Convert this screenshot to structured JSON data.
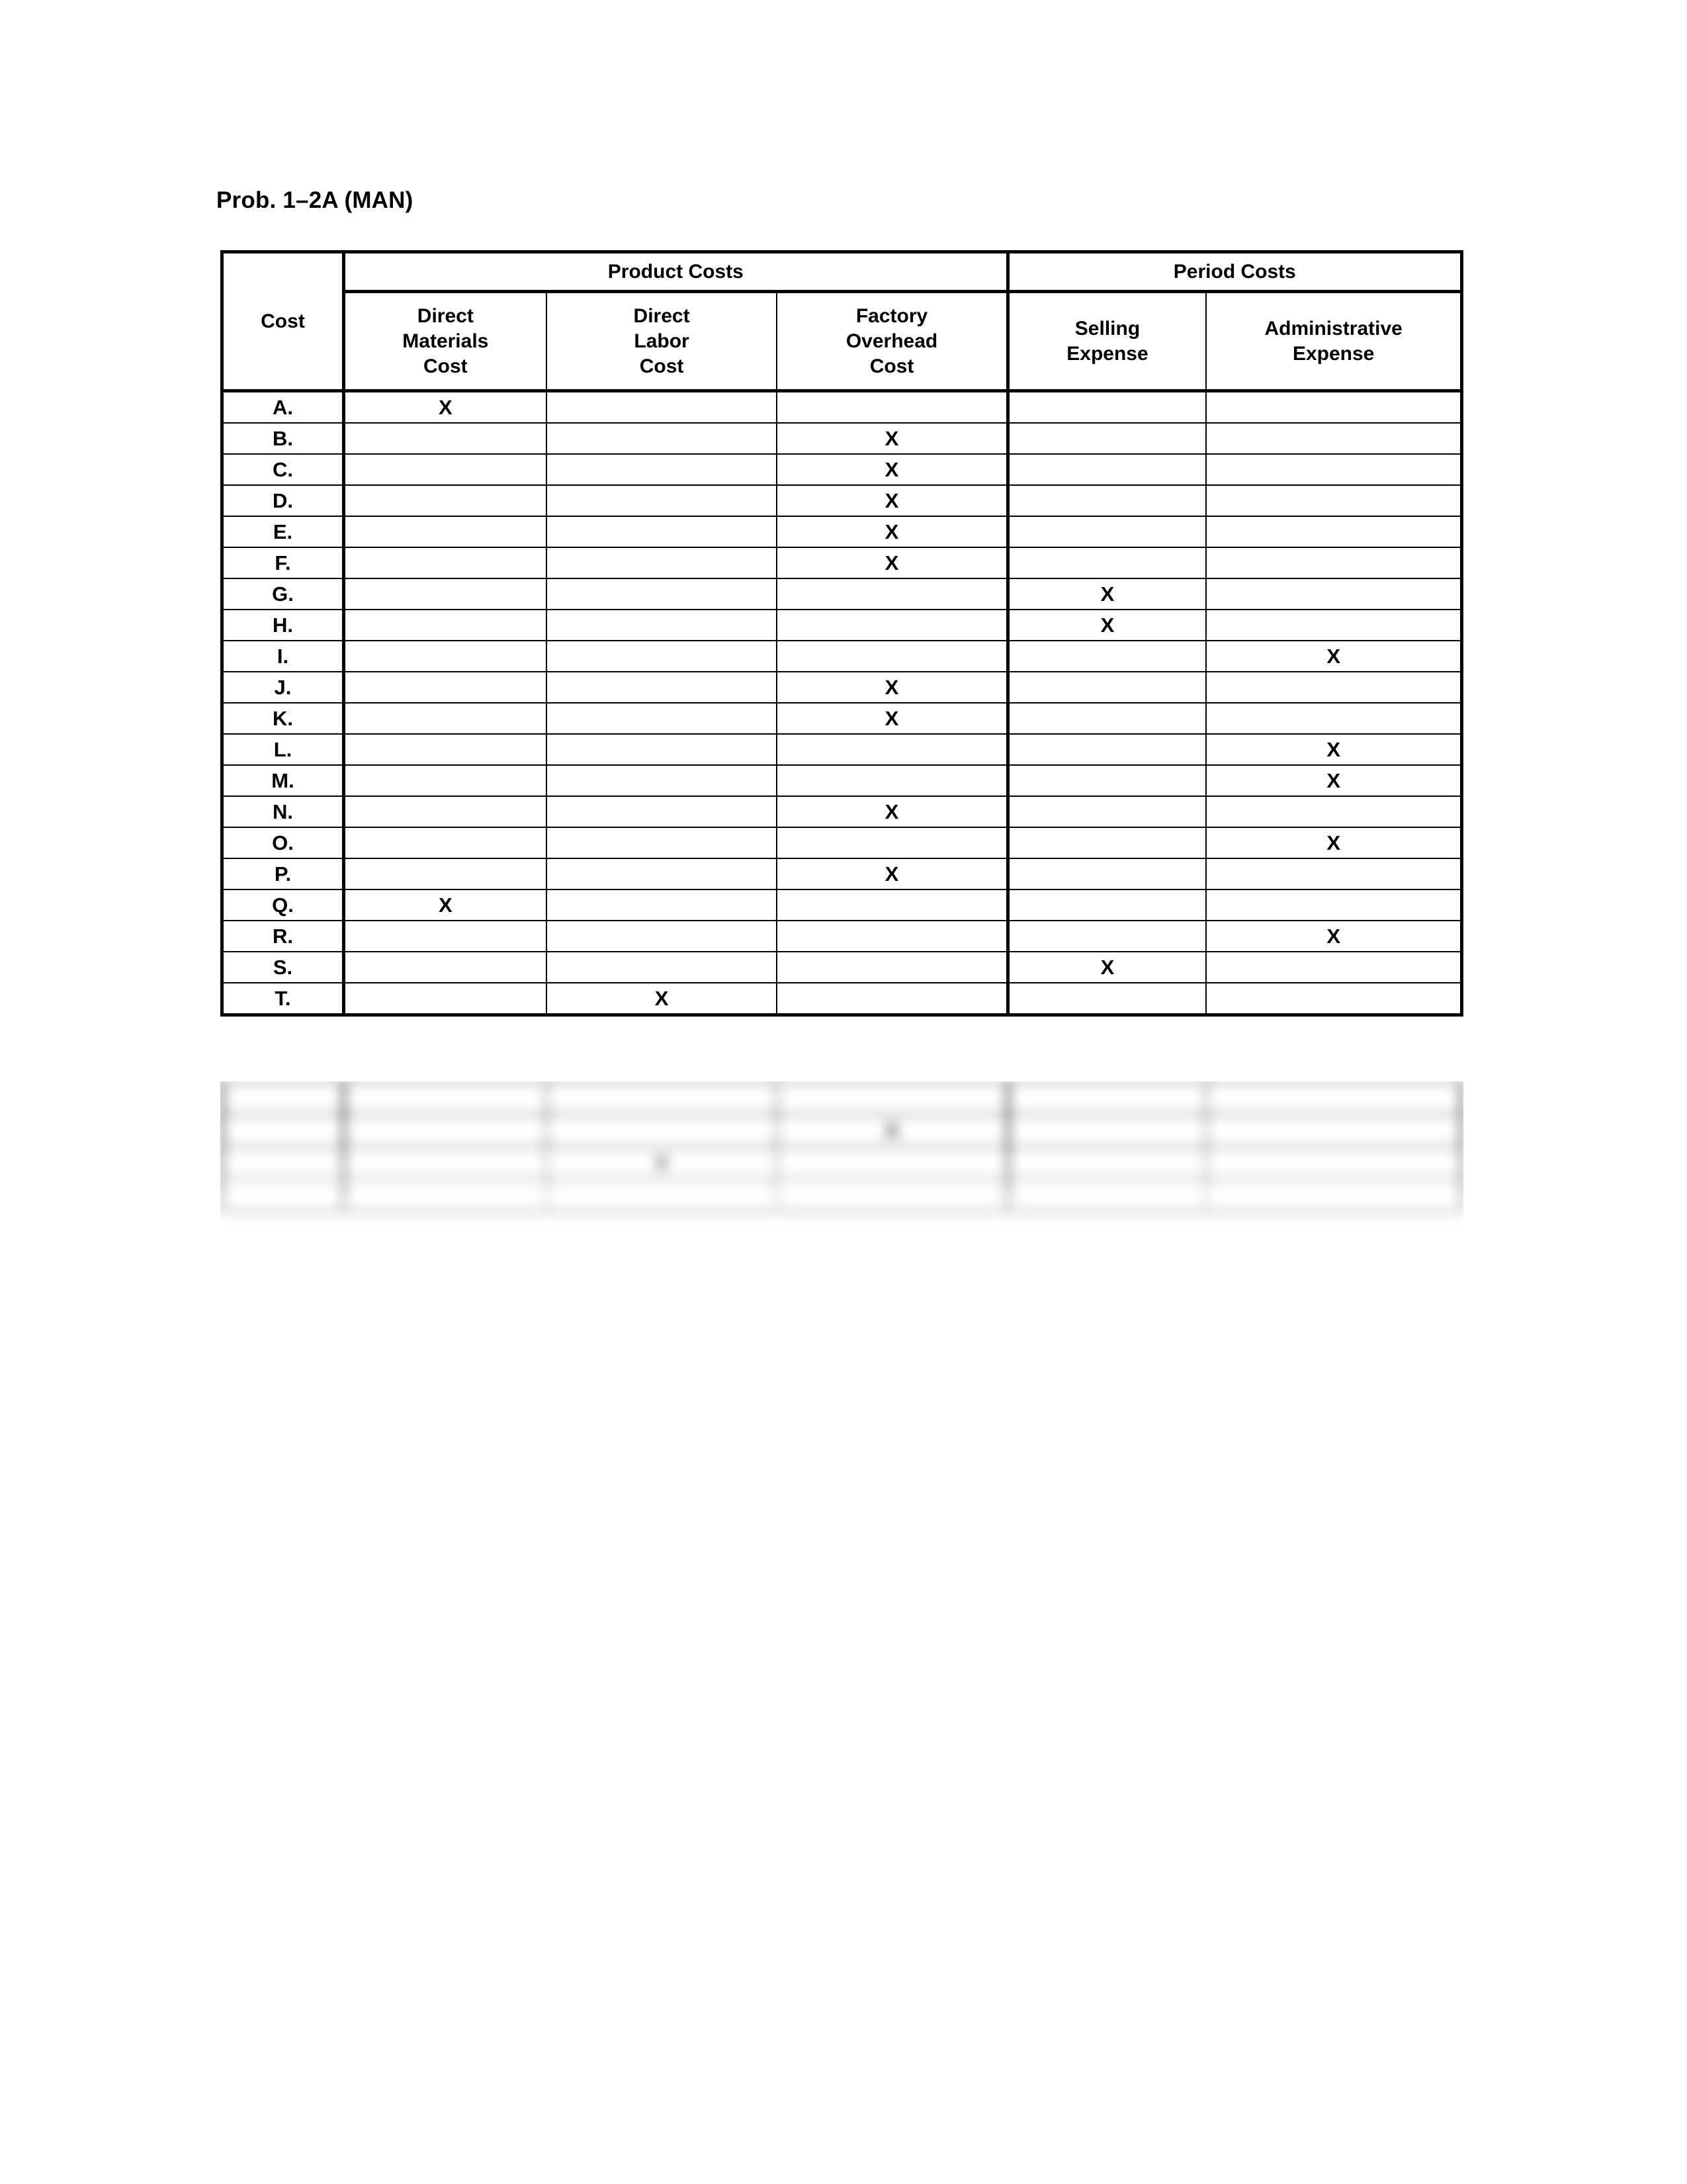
{
  "document": {
    "title": "Prob. 1–2A (MAN)"
  },
  "table": {
    "row_label_header": "Cost",
    "group_headers": [
      {
        "label": "Product Costs",
        "span": 3
      },
      {
        "label": "Period Costs",
        "span": 2
      }
    ],
    "column_headers": [
      "Direct\nMaterials\nCost",
      "Direct\nLabor\nCost",
      "Factory\nOverhead\nCost",
      "Selling\nExpense",
      "Administrative\nExpense"
    ],
    "column_headers_lines": [
      [
        "Direct",
        "Materials",
        "Cost"
      ],
      [
        "Direct",
        "Labor",
        "Cost"
      ],
      [
        "Factory",
        "Overhead",
        "Cost"
      ],
      [
        "Selling",
        "Expense"
      ],
      [
        "Administrative",
        "Expense"
      ]
    ],
    "mark": "X",
    "rows": [
      {
        "label": "A.",
        "marks": [
          "X",
          "",
          "",
          "",
          ""
        ]
      },
      {
        "label": "B.",
        "marks": [
          "",
          "",
          "X",
          "",
          ""
        ]
      },
      {
        "label": "C.",
        "marks": [
          "",
          "",
          "X",
          "",
          ""
        ]
      },
      {
        "label": "D.",
        "marks": [
          "",
          "",
          "X",
          "",
          ""
        ]
      },
      {
        "label": "E.",
        "marks": [
          "",
          "",
          "X",
          "",
          ""
        ]
      },
      {
        "label": "F.",
        "marks": [
          "",
          "",
          "X",
          "",
          ""
        ]
      },
      {
        "label": "G.",
        "marks": [
          "",
          "",
          "",
          "X",
          ""
        ]
      },
      {
        "label": "H.",
        "marks": [
          "",
          "",
          "",
          "X",
          ""
        ]
      },
      {
        "label": "I.",
        "marks": [
          "",
          "",
          "",
          "",
          "X"
        ]
      },
      {
        "label": "J.",
        "marks": [
          "",
          "",
          "X",
          "",
          ""
        ]
      },
      {
        "label": "K.",
        "marks": [
          "",
          "",
          "X",
          "",
          ""
        ]
      },
      {
        "label": "L.",
        "marks": [
          "",
          "",
          "",
          "",
          "X"
        ]
      },
      {
        "label": "M.",
        "marks": [
          "",
          "",
          "",
          "",
          "X"
        ]
      },
      {
        "label": "N.",
        "marks": [
          "",
          "",
          "X",
          "",
          ""
        ]
      },
      {
        "label": "O.",
        "marks": [
          "",
          "",
          "",
          "",
          "X"
        ]
      },
      {
        "label": "P.",
        "marks": [
          "",
          "",
          "X",
          "",
          ""
        ]
      },
      {
        "label": "Q.",
        "marks": [
          "X",
          "",
          "",
          "",
          ""
        ]
      },
      {
        "label": "R.",
        "marks": [
          "",
          "",
          "",
          "",
          "X"
        ]
      },
      {
        "label": "S.",
        "marks": [
          "",
          "",
          "",
          "X",
          ""
        ]
      },
      {
        "label": "T.",
        "marks": [
          "",
          "X",
          "",
          "",
          ""
        ]
      }
    ],
    "obscured_rows": [
      {
        "label": "",
        "marks": [
          "",
          "",
          "",
          "",
          ""
        ]
      },
      {
        "label": "",
        "marks": [
          "",
          "",
          "X",
          "",
          ""
        ]
      },
      {
        "label": "",
        "marks": [
          "",
          "X",
          "",
          "",
          ""
        ]
      },
      {
        "label": "",
        "marks": [
          "",
          "",
          "",
          "",
          ""
        ]
      }
    ]
  },
  "colors": {
    "page_background": "#ffffff",
    "rule": "#000000",
    "text": "#000000"
  }
}
